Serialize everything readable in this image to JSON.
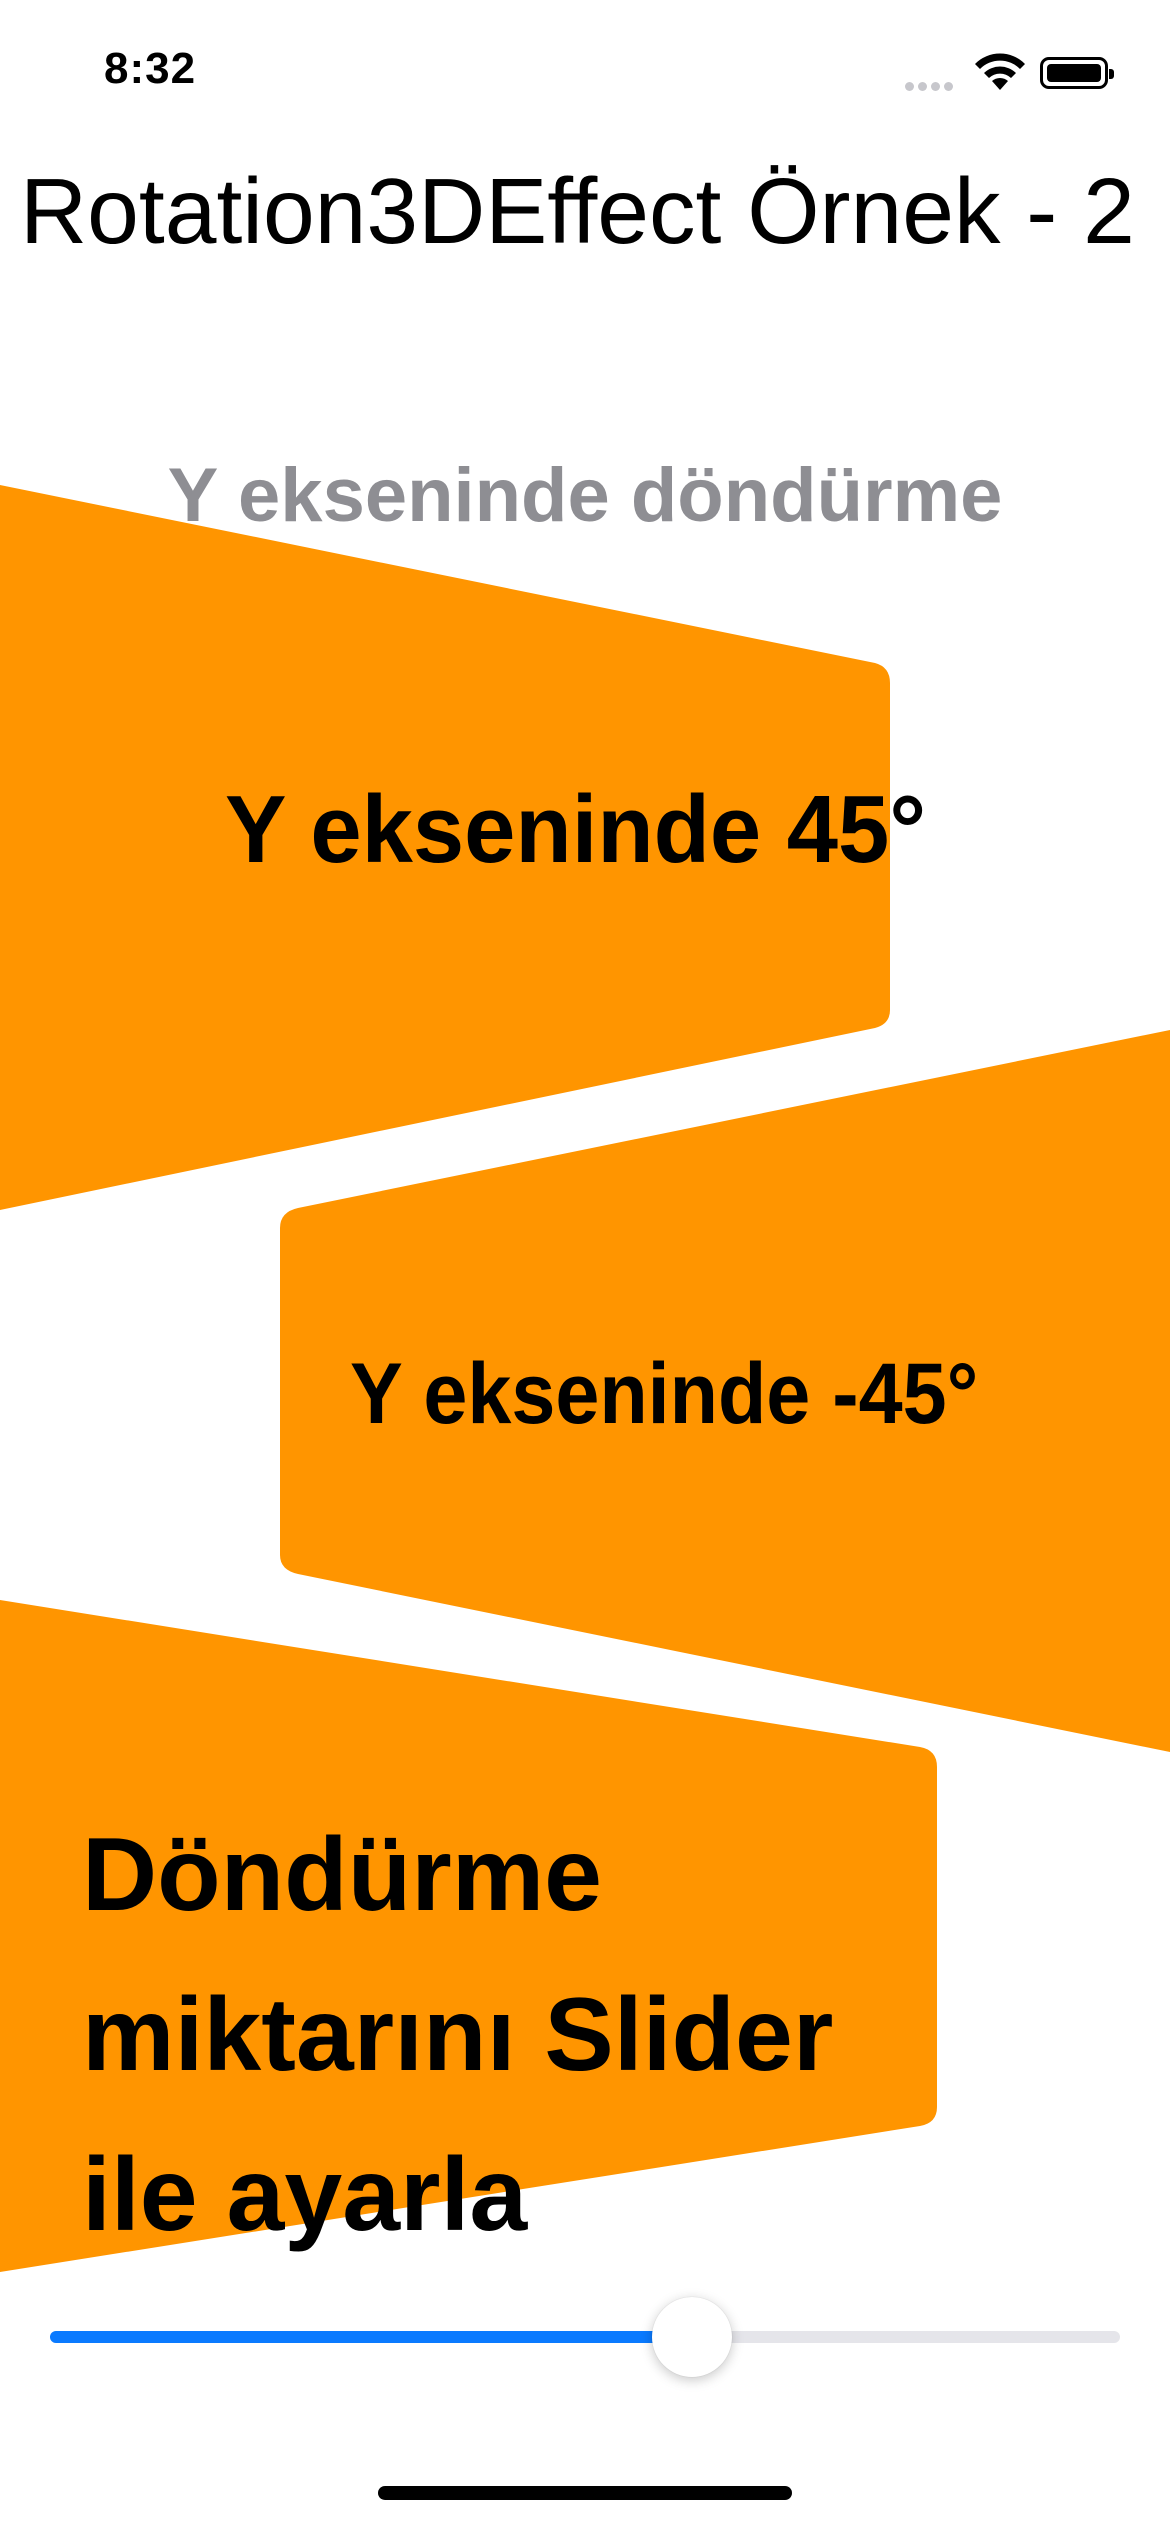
{
  "status_bar": {
    "time": "8:32"
  },
  "header": {
    "title": "Rotation3DEffect Örnek - 2"
  },
  "section": {
    "subtitle": "Y ekseninde döndürme"
  },
  "cards": [
    {
      "label": "Y ekseninde 45°"
    },
    {
      "label": "Y ekseninde -45°"
    },
    {
      "label": "Döndürme miktarını Slider ile ayarla"
    }
  ],
  "slider": {
    "value": 0.6
  },
  "colors": {
    "card": "#ff9500",
    "accent": "#0a7aff",
    "subtitle": "#8e8e93"
  }
}
